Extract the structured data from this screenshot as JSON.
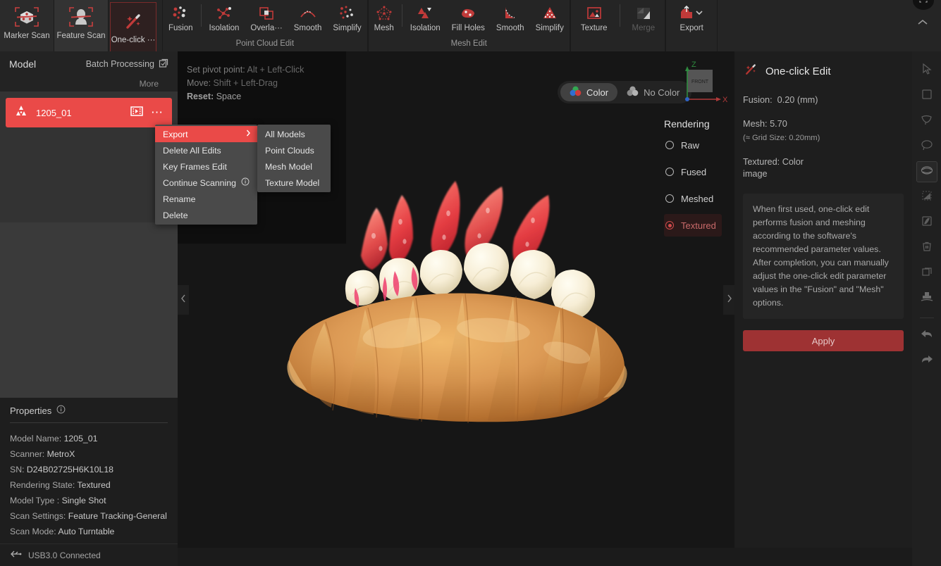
{
  "toolbar": {
    "scan_buttons": [
      {
        "label": "Marker Scan",
        "icon": "marker-scan-icon"
      },
      {
        "label": "Feature Scan",
        "icon": "feature-scan-icon"
      }
    ],
    "oneclick": {
      "label": "One-click ···",
      "icon": "magic-wand-icon"
    },
    "point_cloud": {
      "caption": "Point Cloud Edit",
      "items": [
        {
          "label": "Fusion",
          "icon": "fusion-icon"
        },
        {
          "label": "Isolation",
          "icon": "isolation-icon"
        },
        {
          "label": "Overla···",
          "icon": "overlap-icon"
        },
        {
          "label": "Smooth",
          "icon": "smooth-icon"
        },
        {
          "label": "Simplify",
          "icon": "simplify-icon"
        }
      ]
    },
    "mesh": {
      "caption": "Mesh Edit",
      "items": [
        {
          "label": "Mesh",
          "icon": "mesh-icon"
        },
        {
          "label": "Isolation",
          "icon": "mesh-isolation-icon"
        },
        {
          "label": "Fill Holes",
          "icon": "fill-holes-icon"
        },
        {
          "label": "Smooth",
          "icon": "mesh-smooth-icon"
        },
        {
          "label": "Simplify",
          "icon": "mesh-simplify-icon"
        }
      ]
    },
    "texture_group": {
      "items": [
        {
          "label": "Texture",
          "icon": "texture-icon",
          "disabled": false
        },
        {
          "label": "Merge",
          "icon": "merge-icon",
          "disabled": true
        }
      ]
    },
    "export": {
      "label": "Export",
      "icon": "export-icon"
    },
    "collapse_icon": "chevron-up-icon"
  },
  "left_panel": {
    "title": "Model",
    "batch_processing": "Batch Processing",
    "batch_icon": "batch-copy-icon",
    "more": "More",
    "model": {
      "name": "1205_01",
      "type_icon": "mesh-model-icon",
      "frames_icon": "key-frames-icon",
      "menu_icon": "ellipsis-icon"
    },
    "properties": {
      "heading": "Properties",
      "info_icon": "info-icon",
      "rows": [
        {
          "key": "Model Name:",
          "value": "1205_01"
        },
        {
          "key": "Scanner:",
          "value": "MetroX"
        },
        {
          "key": "SN:",
          "value": "D24B02725H6K10L18"
        },
        {
          "key": "Rendering State:",
          "value": "Textured"
        },
        {
          "key": "Model Type :",
          "value": "Single Shot"
        },
        {
          "key": "Scan Settings:",
          "value": "Feature Tracking-General"
        },
        {
          "key": "Scan Mode:",
          "value": "Auto Turntable"
        }
      ]
    },
    "status": {
      "text": "USB3.0 Connected",
      "icon": "usb-icon"
    }
  },
  "context_menu": {
    "items": [
      {
        "label": "Export",
        "highlighted": true,
        "has_submenu": true,
        "arrow_icon": "chevron-right-icon"
      },
      {
        "label": "Delete All Edits",
        "highlighted": false,
        "has_submenu": false
      },
      {
        "label": "Key Frames Edit",
        "highlighted": false,
        "has_submenu": false
      },
      {
        "label": "Continue Scanning",
        "highlighted": false,
        "has_submenu": false,
        "trailing_icon": "info-icon"
      },
      {
        "label": "Rename",
        "highlighted": false,
        "has_submenu": false
      },
      {
        "label": "Delete",
        "highlighted": false,
        "has_submenu": false
      }
    ],
    "submenu": [
      {
        "label": "All Models"
      },
      {
        "label": "Point Clouds"
      },
      {
        "label": "Mesh Model"
      },
      {
        "label": "Texture Model"
      }
    ]
  },
  "viewport": {
    "hints": [
      {
        "key": "Set pivot point:",
        "value": "Alt + Left-Click",
        "highlighted": false
      },
      {
        "key": "Move:",
        "value": "Shift + Left-Drag",
        "highlighted": false
      },
      {
        "key": "Reset:",
        "value": "Space",
        "highlighted": true
      }
    ],
    "color_toggle": {
      "options": [
        {
          "label": "Color",
          "selected": true,
          "icon": "color-balls-icon"
        },
        {
          "label": "No Color",
          "selected": false,
          "icon": "gray-balls-icon"
        }
      ]
    },
    "gizmo": {
      "z_label": "Z",
      "x_label": "X",
      "face_label": "FRONT"
    },
    "rendering": {
      "title": "Rendering",
      "options": [
        {
          "label": "Raw",
          "selected": false
        },
        {
          "label": "Fused",
          "selected": false
        },
        {
          "label": "Meshed",
          "selected": false
        },
        {
          "label": "Textured",
          "selected": true
        }
      ]
    },
    "nav_left_icon": "chevron-left-icon",
    "nav_right_icon": "chevron-right-icon",
    "model_description": "Strawberry cream croissant 3D scan"
  },
  "right_panel": {
    "title": "One-click Edit",
    "title_icon": "magic-wand-icon",
    "fusion_label": "Fusion:",
    "fusion_value": "0.20 (mm)",
    "mesh_label": "Mesh:",
    "mesh_value": "5.70",
    "grid_note": "(≈ Grid Size: 0.20mm)",
    "textured_label": "Textured: Color",
    "textured_value": "image",
    "info_text": "When first used, one-click edit performs fusion and meshing according to the software's recommended parameter values. After completion, you can manually adjust the one-click edit parameter values in the \"Fusion\" and \"Mesh\" options.",
    "apply_label": "Apply"
  },
  "right_rail": {
    "items": [
      {
        "icon": "cursor-select-icon",
        "selected": false
      },
      {
        "icon": "rectangle-select-icon",
        "selected": false
      },
      {
        "icon": "lasso-select-icon",
        "selected": false
      },
      {
        "icon": "ellipse-select-icon",
        "selected": false
      },
      {
        "icon": "brush-select-icon",
        "selected": true
      },
      {
        "icon": "triangle-select-icon",
        "selected": false
      },
      {
        "icon": "invert-select-icon",
        "selected": false
      },
      {
        "icon": "delete-icon",
        "selected": false
      },
      {
        "icon": "duplicate-icon",
        "selected": false
      },
      {
        "icon": "stamp-icon",
        "selected": false
      },
      {
        "icon": "undo-icon",
        "selected": false
      },
      {
        "icon": "redo-icon",
        "selected": false
      }
    ]
  },
  "colors": {
    "accent_red": "#ea4a48",
    "dark_red": "#9e3233",
    "panel_bg": "#1e1e1e",
    "toolbar_bg": "#252525",
    "viewport_bg": "#161616"
  }
}
